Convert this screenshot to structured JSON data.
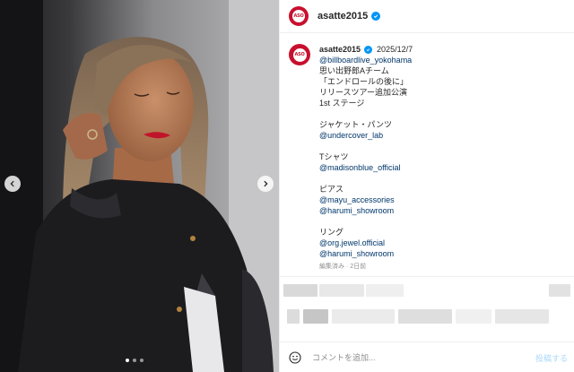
{
  "account": {
    "username": "asatte2015",
    "avatar_text": "ASO",
    "verified_icon": "verified-badge-icon"
  },
  "caption": {
    "username": "asatte2015",
    "date": "2025/12/7",
    "lines": [
      {
        "text": "@billboardlive_yokohama",
        "mention": true
      },
      {
        "text": "思い出野郎Aチーム",
        "mention": false
      },
      {
        "text": "「エンドロールの後に」",
        "mention": false
      },
      {
        "text": "リリースツアー追加公演",
        "mention": false
      },
      {
        "text": "1st ステージ",
        "mention": false
      },
      {
        "text": "",
        "mention": false
      },
      {
        "text": "ジャケット・パンツ",
        "mention": false
      },
      {
        "text": "@undercover_lab",
        "mention": true
      },
      {
        "text": "",
        "mention": false
      },
      {
        "text": "Tシャツ",
        "mention": false
      },
      {
        "text": "@madisonblue_official",
        "mention": true
      },
      {
        "text": "",
        "mention": false
      },
      {
        "text": "ピアス",
        "mention": false
      },
      {
        "text": "@mayu_accessories",
        "mention": true
      },
      {
        "text": "@harumi_showroom",
        "mention": true
      },
      {
        "text": "",
        "mention": false
      },
      {
        "text": "リング",
        "mention": false
      },
      {
        "text": "@org.jewel.official",
        "mention": true
      },
      {
        "text": "@harumi_showroom",
        "mention": true
      }
    ],
    "meta": "編集済み · 2日前"
  },
  "carousel": {
    "total_slides": 3,
    "active_slide": 1,
    "prev_icon": "chevron-left-icon",
    "next_icon": "chevron-right-icon"
  },
  "composer": {
    "placeholder": "コメントを追加...",
    "value": "",
    "post_label": "投稿する",
    "emoji_icon": "emoji-icon"
  },
  "colors": {
    "mention": "#00376b",
    "verified": "#0095f6",
    "brand_red": "#c8102e",
    "post_disabled": "#a8d8f8"
  }
}
